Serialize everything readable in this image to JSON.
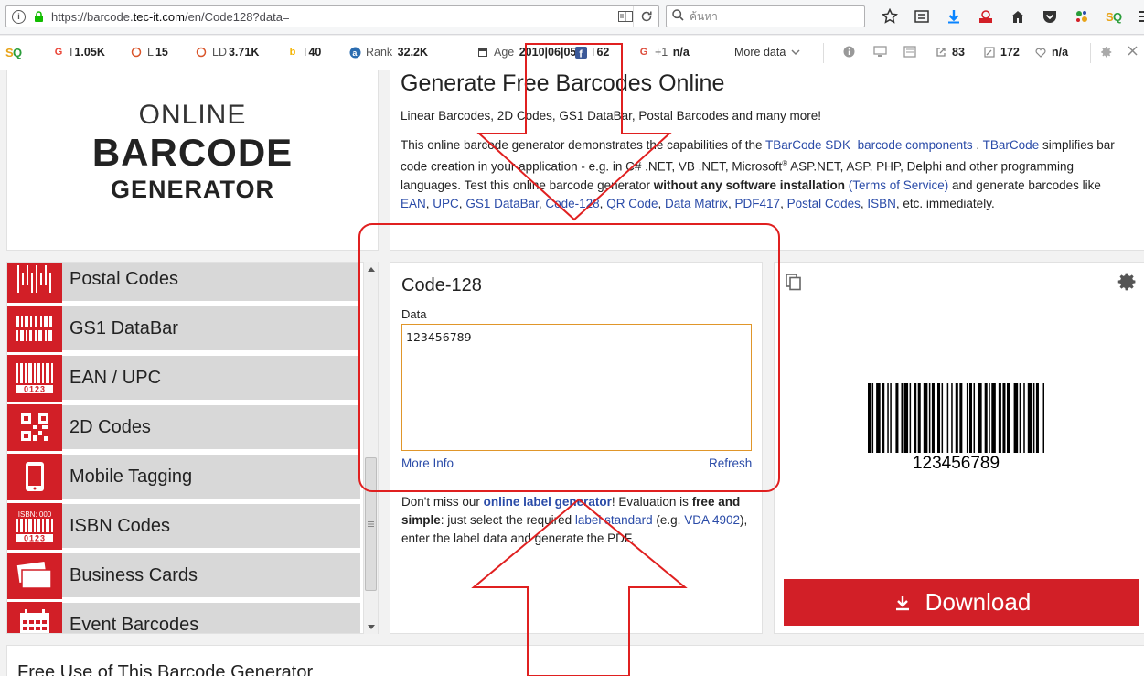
{
  "browser": {
    "url_prefix": "https://barcode.",
    "url_host": "tec-it.com",
    "url_path": "/en/Code128?data=",
    "search_placeholder": "ค้นหา"
  },
  "seo": {
    "google_label": "I",
    "google_value": "1.05K",
    "links_label": "L",
    "links_value": "15",
    "ld_label": "LD",
    "ld_value": "3.71K",
    "bing_label": "I",
    "bing_value": "40",
    "rank_label": "Rank",
    "rank_value": "32.2K",
    "age_label": "Age",
    "age_value": "2010|06|05",
    "fb_label": "I",
    "fb_value": "62",
    "gplus_label": "+1",
    "gplus_value": "n/a",
    "more_data": "More data",
    "ext_value": "83",
    "edit_value": "172",
    "heart_value": "n/a"
  },
  "logo": {
    "line1": "ONLINE",
    "line2": "BARCODE",
    "line3": "GENERATOR"
  },
  "intro": {
    "title": "Generate Free Barcodes Online",
    "subtitle": "Linear Barcodes, 2D Codes, GS1 DataBar, Postal Barcodes and many more!",
    "p1": "This online barcode generator demonstrates the capabilities of the ",
    "link_sdk": "TBarCode SDK",
    "link_components": "barcode components",
    "p2": " . ",
    "link_tbarcode": "TBarCode",
    "p3": " simplifies bar code creation in your application - e.g. in C# .NET, VB .NET, Microsoft",
    "reg": "®",
    "p4": " ASP.NET, ASP, PHP, Delphi and other programming languages. Test this online barcode generator ",
    "bold_install": "without any software installation",
    "link_tos": "(Terms of Service)",
    "p5": " and generate barcodes like ",
    "link_ean": "EAN",
    "link_upc": "UPC",
    "link_gs1": "GS1 DataBar",
    "link_code128": "Code-128",
    "link_qr": "QR Code",
    "link_dm": "Data Matrix",
    "link_pdf": "PDF417",
    "link_postal": "Postal Codes",
    "link_isbn": "ISBN",
    "p6": ", etc. immediately.",
    "comma": ", "
  },
  "sidebar": {
    "items": [
      {
        "label": "Postal Codes",
        "icon": "postal-barcode-icon"
      },
      {
        "label": "GS1 DataBar",
        "icon": "gs1-databar-icon"
      },
      {
        "label": "EAN / UPC",
        "icon": "ean-upc-icon"
      },
      {
        "label": "2D Codes",
        "icon": "qr-code-icon"
      },
      {
        "label": "Mobile Tagging",
        "icon": "mobile-phone-icon"
      },
      {
        "label": "ISBN Codes",
        "icon": "isbn-barcode-icon"
      },
      {
        "label": "Business Cards",
        "icon": "business-cards-icon"
      },
      {
        "label": "Event Barcodes",
        "icon": "calendar-icon"
      }
    ],
    "ean_digits": "0123",
    "isbn_text": "ISBN: 000",
    "isbn_digits": "0123"
  },
  "code_panel": {
    "title": "Code-128",
    "data_label": "Data",
    "data_value": "123456789",
    "more_info": "More Info",
    "refresh": "Refresh",
    "promo_1": "Don't miss our ",
    "promo_link": "online label generator",
    "promo_2": "! Evaluation is ",
    "promo_bold": "free and simple",
    "promo_3": ": just select the required ",
    "promo_link2": "label standard",
    "promo_4": " (e.g. ",
    "promo_link3": "VDA 4902",
    "promo_5": "), enter the label data and generate the PDF."
  },
  "barcode": {
    "text": "123456789",
    "download_label": "Download"
  },
  "free_use": {
    "title": "Free Use of This Barcode Generator"
  },
  "colors": {
    "accent_red": "#d21f27",
    "annotation_red": "#e02020",
    "link_blue": "#2a4ba8",
    "input_border": "#e0962a"
  }
}
